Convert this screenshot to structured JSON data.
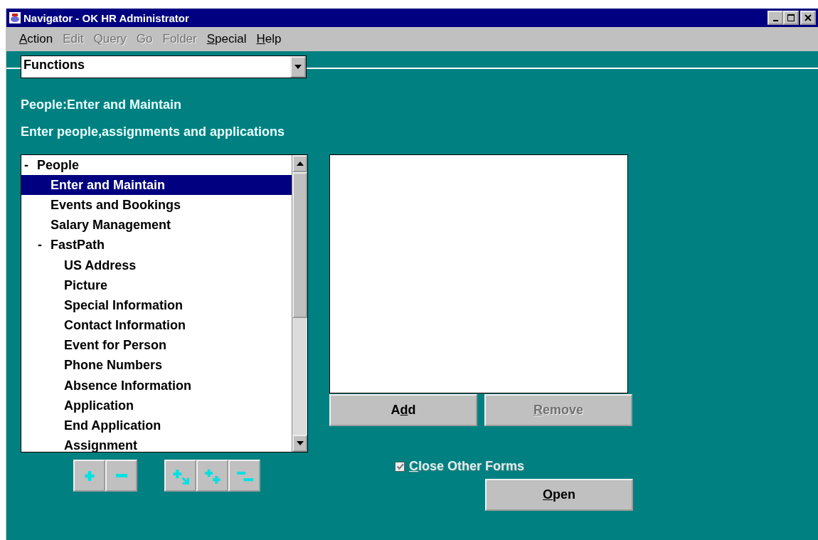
{
  "window": {
    "title": "Navigator - OK HR Administrator"
  },
  "menu": [
    {
      "key": "A",
      "after": "ction",
      "disabled": false
    },
    {
      "after": "Edit",
      "disabled": true
    },
    {
      "after": "Query",
      "disabled": true
    },
    {
      "after": "Go",
      "disabled": true
    },
    {
      "after": "Folder",
      "disabled": true
    },
    {
      "key": "S",
      "after": "pecial",
      "disabled": false
    },
    {
      "key": "H",
      "after": "elp",
      "disabled": false
    }
  ],
  "selector": {
    "value": "Functions"
  },
  "heading": "People:Enter and Maintain",
  "description": "Enter people,assignments and applications",
  "tree": [
    {
      "marker": "-",
      "label": "People",
      "selected": false,
      "children": [
        {
          "label": "Enter and Maintain",
          "selected": true
        },
        {
          "label": "Events and Bookings",
          "selected": false
        },
        {
          "label": "Salary Management",
          "selected": false
        },
        {
          "marker": "-",
          "label": "FastPath",
          "selected": false,
          "children": [
            {
              "label": "US Address",
              "selected": false
            },
            {
              "label": "Picture",
              "selected": false
            },
            {
              "label": "Special Information",
              "selected": false
            },
            {
              "label": "Contact Information",
              "selected": false
            },
            {
              "label": "Event for Person",
              "selected": false
            },
            {
              "label": "Phone Numbers",
              "selected": false
            },
            {
              "label": "Absence Information",
              "selected": false
            },
            {
              "label": "Application",
              "selected": false
            },
            {
              "label": "End Application",
              "selected": false
            },
            {
              "label": "Assignment",
              "selected": false
            }
          ]
        }
      ]
    }
  ],
  "tree_tools": [
    {
      "kind": "expand"
    },
    {
      "kind": "collapse"
    },
    {
      "kind": "expand-branch"
    },
    {
      "kind": "expand-all"
    },
    {
      "kind": "collapse-all"
    }
  ],
  "list_buttons": [
    {
      "before": "A",
      "key": "d",
      "after": "d",
      "disabled": false
    },
    {
      "key": "R",
      "after": "emove",
      "disabled": true
    }
  ],
  "close_other_forms": {
    "key": "C",
    "after": "lose Other Forms",
    "checked": true
  },
  "open_button": {
    "key": "O",
    "after": "pen",
    "disabled": false
  }
}
